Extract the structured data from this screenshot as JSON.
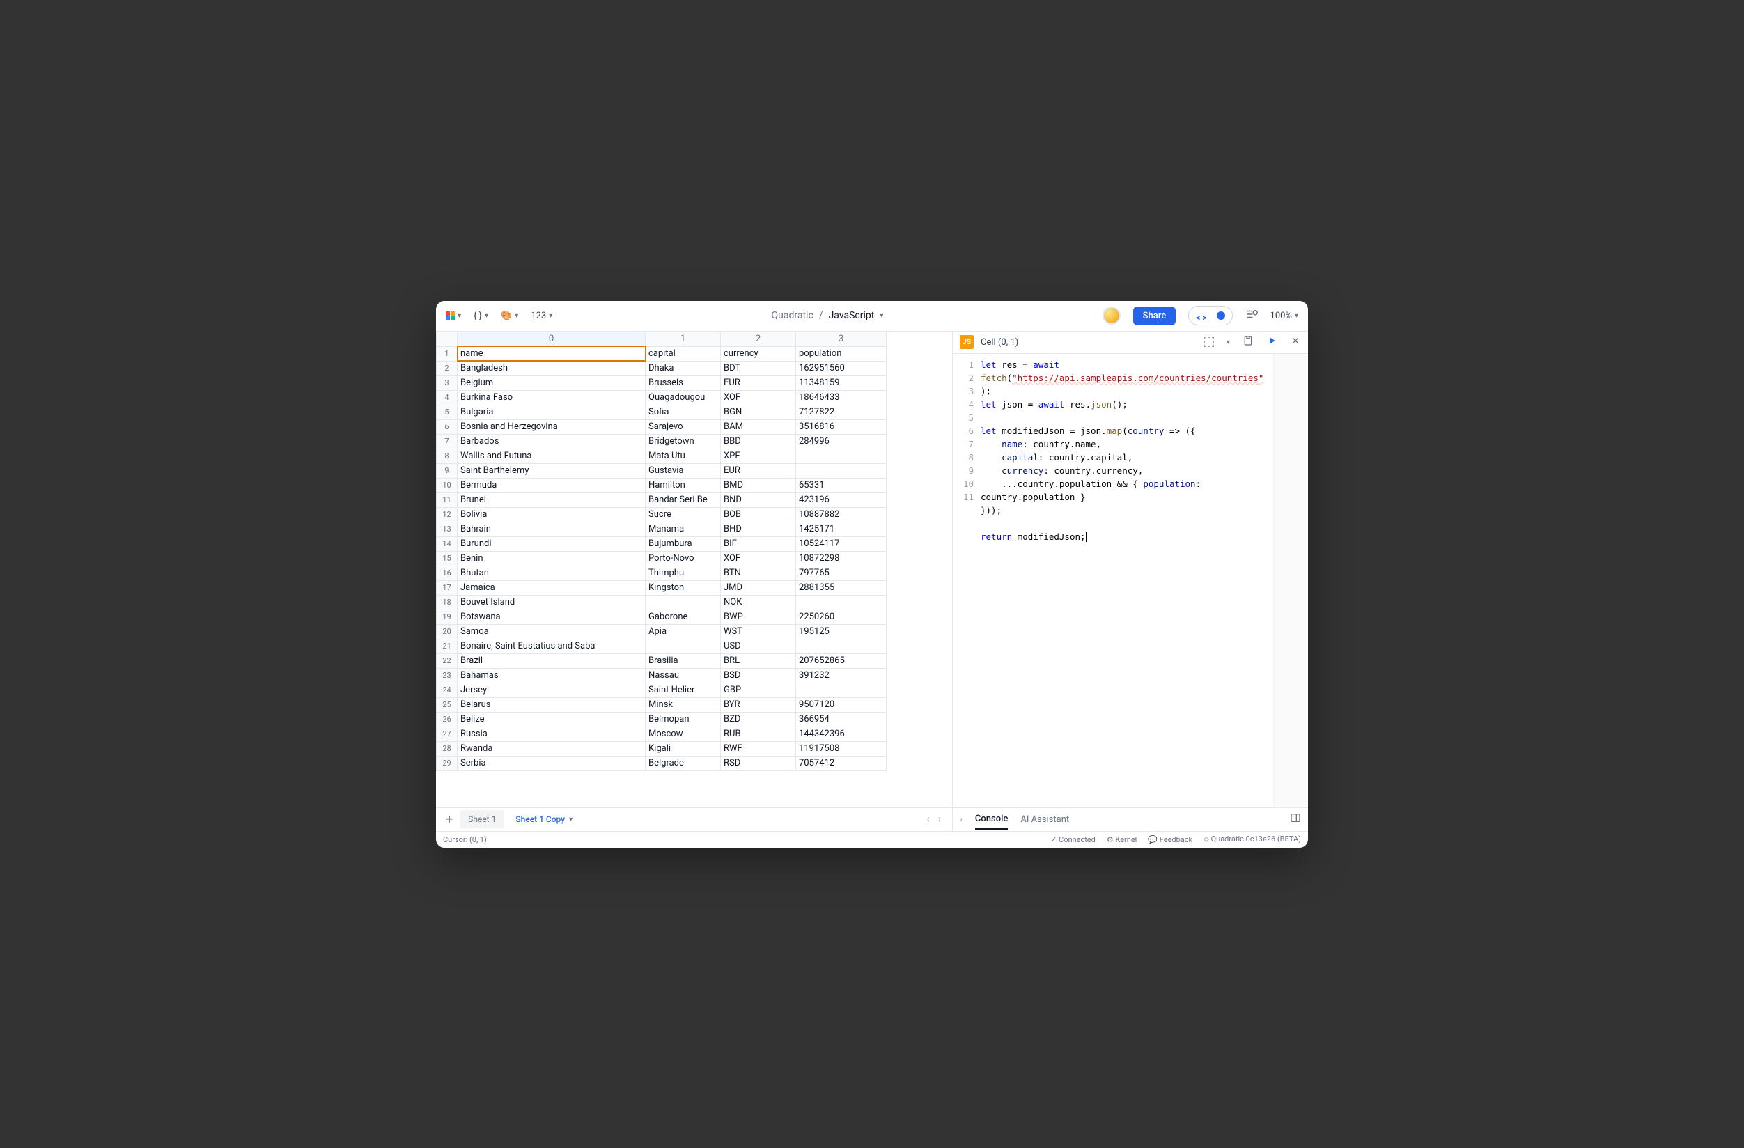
{
  "app": {
    "name": "Quadratic",
    "doc": "JavaScript"
  },
  "toolbar": {
    "format_number": "123",
    "zoom": "100%"
  },
  "share_label": "Share",
  "columns": [
    "0",
    "1",
    "2",
    "3"
  ],
  "headers": [
    "name",
    "capital",
    "currency",
    "population"
  ],
  "rows": [
    {
      "n": 1,
      "c": [
        "name",
        "capital",
        "currency",
        "population"
      ]
    },
    {
      "n": 2,
      "c": [
        "Bangladesh",
        "Dhaka",
        "BDT",
        "162951560"
      ]
    },
    {
      "n": 3,
      "c": [
        "Belgium",
        "Brussels",
        "EUR",
        "11348159"
      ]
    },
    {
      "n": 4,
      "c": [
        "Burkina Faso",
        "Ouagadougou",
        "XOF",
        "18646433"
      ]
    },
    {
      "n": 5,
      "c": [
        "Bulgaria",
        "Sofia",
        "BGN",
        "7127822"
      ]
    },
    {
      "n": 6,
      "c": [
        "Bosnia and Herzegovina",
        "Sarajevo",
        "BAM",
        "3516816"
      ]
    },
    {
      "n": 7,
      "c": [
        "Barbados",
        "Bridgetown",
        "BBD",
        "284996"
      ]
    },
    {
      "n": 8,
      "c": [
        "Wallis and Futuna",
        "Mata Utu",
        "XPF",
        ""
      ]
    },
    {
      "n": 9,
      "c": [
        "Saint Barthelemy",
        "Gustavia",
        "EUR",
        ""
      ]
    },
    {
      "n": 10,
      "c": [
        "Bermuda",
        "Hamilton",
        "BMD",
        "65331"
      ]
    },
    {
      "n": 11,
      "c": [
        "Brunei",
        "Bandar Seri Be",
        "BND",
        "423196"
      ]
    },
    {
      "n": 12,
      "c": [
        "Bolivia",
        "Sucre",
        "BOB",
        "10887882"
      ]
    },
    {
      "n": 13,
      "c": [
        "Bahrain",
        "Manama",
        "BHD",
        "1425171"
      ]
    },
    {
      "n": 14,
      "c": [
        "Burundi",
        "Bujumbura",
        "BIF",
        "10524117"
      ]
    },
    {
      "n": 15,
      "c": [
        "Benin",
        "Porto-Novo",
        "XOF",
        "10872298"
      ]
    },
    {
      "n": 16,
      "c": [
        "Bhutan",
        "Thimphu",
        "BTN",
        "797765"
      ]
    },
    {
      "n": 17,
      "c": [
        "Jamaica",
        "Kingston",
        "JMD",
        "2881355"
      ]
    },
    {
      "n": 18,
      "c": [
        "Bouvet Island",
        "",
        "NOK",
        ""
      ]
    },
    {
      "n": 19,
      "c": [
        "Botswana",
        "Gaborone",
        "BWP",
        "2250260"
      ]
    },
    {
      "n": 20,
      "c": [
        "Samoa",
        "Apia",
        "WST",
        "195125"
      ]
    },
    {
      "n": 21,
      "c": [
        "Bonaire, Saint Eustatius and Saba",
        "",
        "USD",
        ""
      ]
    },
    {
      "n": 22,
      "c": [
        "Brazil",
        "Brasilia",
        "BRL",
        "207652865"
      ]
    },
    {
      "n": 23,
      "c": [
        "Bahamas",
        "Nassau",
        "BSD",
        "391232"
      ]
    },
    {
      "n": 24,
      "c": [
        "Jersey",
        "Saint Helier",
        "GBP",
        ""
      ]
    },
    {
      "n": 25,
      "c": [
        "Belarus",
        "Minsk",
        "BYR",
        "9507120"
      ]
    },
    {
      "n": 26,
      "c": [
        "Belize",
        "Belmopan",
        "BZD",
        "366954"
      ]
    },
    {
      "n": 27,
      "c": [
        "Russia",
        "Moscow",
        "RUB",
        "144342396"
      ]
    },
    {
      "n": 28,
      "c": [
        "Rwanda",
        "Kigali",
        "RWF",
        "11917508"
      ]
    },
    {
      "n": 29,
      "c": [
        "Serbia",
        "Belgrade",
        "RSD",
        "7057412"
      ]
    }
  ],
  "tabs": {
    "sheet1": "Sheet 1",
    "sheet1copy": "Sheet 1 Copy"
  },
  "status": {
    "cursor": "Cursor: (0, 1)",
    "connected": "Connected",
    "kernel": "Kernel",
    "feedback": "Feedback",
    "version": "Quadratic 0c13e26 (BETA)"
  },
  "editor": {
    "title": "Cell (0, 1)",
    "lines": [
      "1",
      "2",
      "3",
      "4",
      "5",
      "6",
      "7",
      "8",
      "",
      "9",
      "10",
      "11"
    ],
    "url": "https://api.sampleapis.com/countries/countries",
    "code_kw_let": "let",
    "code_kw_await": "await",
    "code_kw_return": "return"
  },
  "console": {
    "tab1": "Console",
    "tab2": "AI Assistant"
  }
}
